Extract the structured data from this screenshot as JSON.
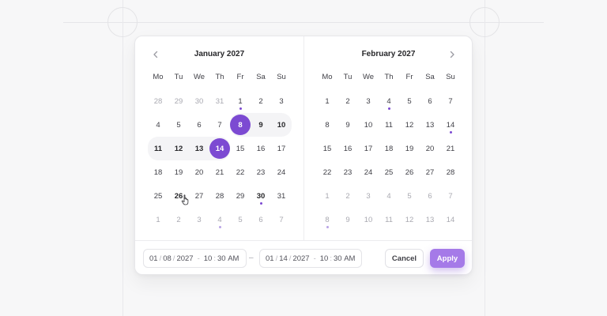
{
  "calendars": [
    {
      "title": "January 2027",
      "weekdays": [
        "Mo",
        "Tu",
        "We",
        "Th",
        "Fr",
        "Sa",
        "Su"
      ],
      "weeks": [
        [
          {
            "d": "28",
            "muted": true
          },
          {
            "d": "29",
            "muted": true
          },
          {
            "d": "30",
            "muted": true
          },
          {
            "d": "31",
            "muted": true
          },
          {
            "d": "1",
            "dot": true
          },
          {
            "d": "2"
          },
          {
            "d": "3"
          }
        ],
        [
          {
            "d": "4"
          },
          {
            "d": "5"
          },
          {
            "d": "6"
          },
          {
            "d": "7"
          },
          {
            "d": "8",
            "selected": true,
            "range": "start"
          },
          {
            "d": "9",
            "range": "mid",
            "bold": true
          },
          {
            "d": "10",
            "range": "end",
            "bold": true
          }
        ],
        [
          {
            "d": "11",
            "range": "start",
            "bold": true
          },
          {
            "d": "12",
            "range": "mid",
            "bold": true
          },
          {
            "d": "13",
            "range": "mid",
            "bold": true
          },
          {
            "d": "14",
            "selected": true,
            "range": "end"
          },
          {
            "d": "15"
          },
          {
            "d": "16"
          },
          {
            "d": "17"
          }
        ],
        [
          {
            "d": "18"
          },
          {
            "d": "19"
          },
          {
            "d": "20"
          },
          {
            "d": "21"
          },
          {
            "d": "22"
          },
          {
            "d": "23"
          },
          {
            "d": "24"
          }
        ],
        [
          {
            "d": "25"
          },
          {
            "d": "26",
            "bold": true
          },
          {
            "d": "27"
          },
          {
            "d": "28"
          },
          {
            "d": "29"
          },
          {
            "d": "30",
            "dot": true,
            "bold": true
          },
          {
            "d": "31"
          }
        ],
        [
          {
            "d": "1",
            "muted": true
          },
          {
            "d": "2",
            "muted": true
          },
          {
            "d": "3",
            "muted": true
          },
          {
            "d": "4",
            "muted": true,
            "dot": true,
            "faint": true
          },
          {
            "d": "5",
            "muted": true
          },
          {
            "d": "6",
            "muted": true
          },
          {
            "d": "7",
            "muted": true
          }
        ]
      ]
    },
    {
      "title": "February 2027",
      "weekdays": [
        "Mo",
        "Tu",
        "We",
        "Th",
        "Fr",
        "Sa",
        "Su"
      ],
      "weeks": [
        [
          {
            "d": "1"
          },
          {
            "d": "2"
          },
          {
            "d": "3"
          },
          {
            "d": "4",
            "dot": true
          },
          {
            "d": "5"
          },
          {
            "d": "6"
          },
          {
            "d": "7"
          }
        ],
        [
          {
            "d": "8"
          },
          {
            "d": "9"
          },
          {
            "d": "10"
          },
          {
            "d": "11"
          },
          {
            "d": "12"
          },
          {
            "d": "13"
          },
          {
            "d": "14",
            "dot": true
          }
        ],
        [
          {
            "d": "15"
          },
          {
            "d": "16"
          },
          {
            "d": "17"
          },
          {
            "d": "18"
          },
          {
            "d": "19"
          },
          {
            "d": "20"
          },
          {
            "d": "21"
          }
        ],
        [
          {
            "d": "22"
          },
          {
            "d": "23"
          },
          {
            "d": "24"
          },
          {
            "d": "25"
          },
          {
            "d": "26"
          },
          {
            "d": "27"
          },
          {
            "d": "28"
          }
        ],
        [
          {
            "d": "1",
            "muted": true
          },
          {
            "d": "2",
            "muted": true
          },
          {
            "d": "3",
            "muted": true
          },
          {
            "d": "4",
            "muted": true
          },
          {
            "d": "5",
            "muted": true
          },
          {
            "d": "6",
            "muted": true
          },
          {
            "d": "7",
            "muted": true
          }
        ],
        [
          {
            "d": "8",
            "muted": true,
            "dot": true,
            "faint": true
          },
          {
            "d": "9",
            "muted": true
          },
          {
            "d": "10",
            "muted": true
          },
          {
            "d": "11",
            "muted": true
          },
          {
            "d": "12",
            "muted": true
          },
          {
            "d": "13",
            "muted": true
          },
          {
            "d": "14",
            "muted": true
          }
        ]
      ]
    }
  ],
  "nav": {
    "prev_icon": "chevron-left-icon",
    "next_icon": "chevron-right-icon"
  },
  "start": {
    "month": "01",
    "day": "08",
    "year": "2027",
    "hour": "10",
    "minute": "30",
    "ampm": "AM"
  },
  "end": {
    "month": "01",
    "day": "14",
    "year": "2027",
    "hour": "10",
    "minute": "30",
    "ampm": "AM"
  },
  "range_dash": "–",
  "actions": {
    "cancel": "Cancel",
    "apply": "Apply"
  },
  "colors": {
    "accent": "#7c4ad2",
    "apply_button": "#a57ae8",
    "range_fill": "#f4f4f6"
  },
  "cursor_icon": "hand-pointer-icon"
}
